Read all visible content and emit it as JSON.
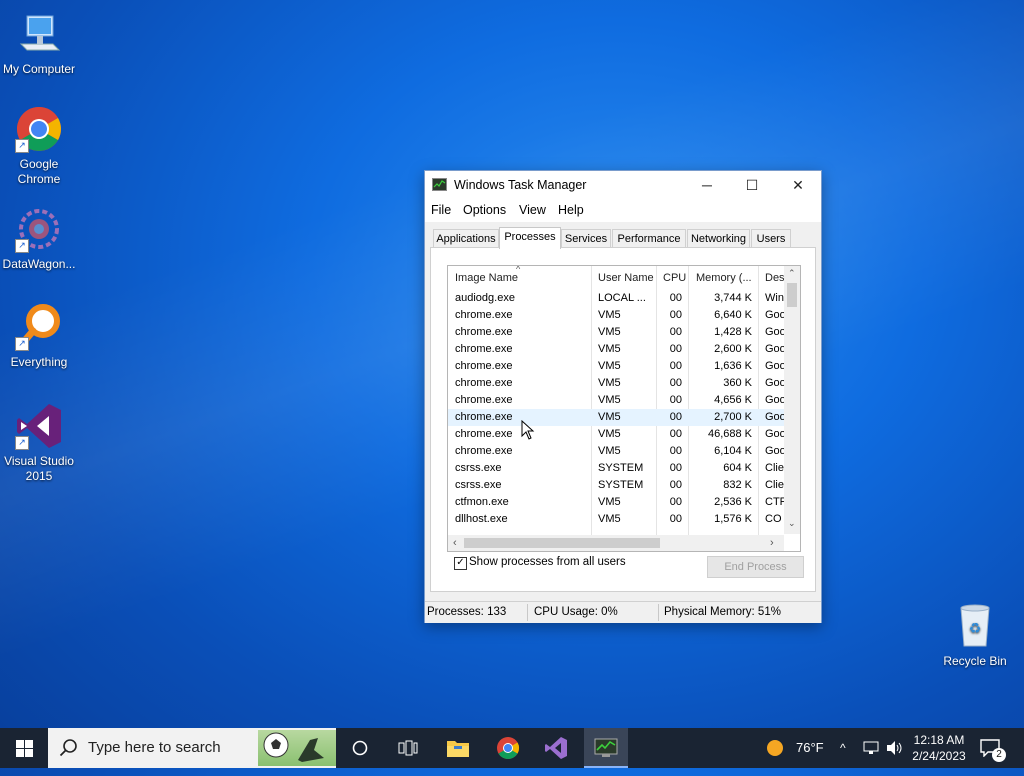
{
  "desktop": {
    "icons": [
      {
        "label": "My Computer",
        "icon": "computer-icon"
      },
      {
        "label": "Google Chrome",
        "icon": "chrome-icon"
      },
      {
        "label": "DataWagon...",
        "icon": "datawagon-icon"
      },
      {
        "label": "Everything",
        "icon": "everything-icon"
      },
      {
        "label": "Visual Studio 2015",
        "icon": "visual-studio-icon"
      },
      {
        "label": "Recycle Bin",
        "icon": "recycle-bin-icon"
      }
    ]
  },
  "window": {
    "title": "Windows Task Manager",
    "menu": [
      "File",
      "Options",
      "View",
      "Help"
    ],
    "tabs": [
      "Applications",
      "Processes",
      "Services",
      "Performance",
      "Networking",
      "Users"
    ],
    "active_tab": "Processes",
    "columns": [
      "Image Name",
      "User Name",
      "CPU",
      "Memory (...",
      "Des"
    ],
    "rows": [
      {
        "name": "audiodg.exe",
        "user": "LOCAL ...",
        "cpu": "00",
        "mem": "3,744 K",
        "desc": "Win"
      },
      {
        "name": "chrome.exe",
        "user": "VM5",
        "cpu": "00",
        "mem": "6,640 K",
        "desc": "Goo"
      },
      {
        "name": "chrome.exe",
        "user": "VM5",
        "cpu": "00",
        "mem": "1,428 K",
        "desc": "Goo"
      },
      {
        "name": "chrome.exe",
        "user": "VM5",
        "cpu": "00",
        "mem": "2,600 K",
        "desc": "Goo"
      },
      {
        "name": "chrome.exe",
        "user": "VM5",
        "cpu": "00",
        "mem": "1,636 K",
        "desc": "Goo"
      },
      {
        "name": "chrome.exe",
        "user": "VM5",
        "cpu": "00",
        "mem": "360 K",
        "desc": "Goo"
      },
      {
        "name": "chrome.exe",
        "user": "VM5",
        "cpu": "00",
        "mem": "4,656 K",
        "desc": "Goo"
      },
      {
        "name": "chrome.exe",
        "user": "VM5",
        "cpu": "00",
        "mem": "2,700 K",
        "desc": "Goo"
      },
      {
        "name": "chrome.exe",
        "user": "VM5",
        "cpu": "00",
        "mem": "46,688 K",
        "desc": "Goo"
      },
      {
        "name": "chrome.exe",
        "user": "VM5",
        "cpu": "00",
        "mem": "6,104 K",
        "desc": "Goo"
      },
      {
        "name": "csrss.exe",
        "user": "SYSTEM",
        "cpu": "00",
        "mem": "604 K",
        "desc": "Clie"
      },
      {
        "name": "csrss.exe",
        "user": "SYSTEM",
        "cpu": "00",
        "mem": "832 K",
        "desc": "Clie"
      },
      {
        "name": "ctfmon.exe",
        "user": "VM5",
        "cpu": "00",
        "mem": "2,536 K",
        "desc": "CTF"
      },
      {
        "name": "dllhost.exe",
        "user": "VM5",
        "cpu": "00",
        "mem": "1,576 K",
        "desc": "CO"
      }
    ],
    "show_all_label": "Show processes from all users",
    "show_all_checked": "✓",
    "end_process_label": "End Process",
    "status": {
      "processes": "Processes: 133",
      "cpu": "CPU Usage: 0%",
      "memory": "Physical Memory: 51%"
    }
  },
  "taskbar": {
    "search_placeholder": "Type here to search",
    "weather": "76°F",
    "time": "12:18 AM",
    "date": "2/24/2023",
    "notification_count": "2"
  }
}
